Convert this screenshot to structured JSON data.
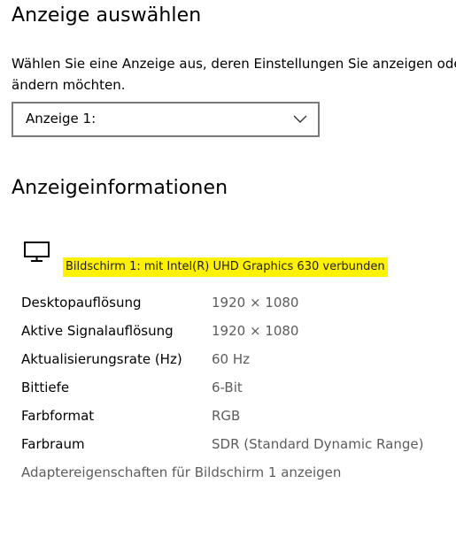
{
  "select_display": {
    "title": "Anzeige auswählen",
    "description_line1": "Wählen Sie eine Anzeige aus, deren Einstellungen Sie anzeigen oder",
    "description_line2": "ändern möchten.",
    "dropdown_value": "Anzeige 1:"
  },
  "display_info": {
    "title": "Anzeigeinformationen",
    "icon": "monitor-icon",
    "adapter_text": "Bildschirm 1: mit Intel(R) UHD Graphics 630 verbunden",
    "highlight_color": "#fff200",
    "rows": [
      {
        "label": "Desktopauflösung",
        "value": "1920 × 1080"
      },
      {
        "label": "Aktive Signalauflösung",
        "value": "1920 × 1080"
      },
      {
        "label": "Aktualisierungsrate (Hz)",
        "value": "60 Hz"
      },
      {
        "label": "Bittiefe",
        "value": "6-Bit"
      },
      {
        "label": "Farbformat",
        "value": "RGB"
      },
      {
        "label": "Farbraum",
        "value": "SDR (Standard Dynamic Range)"
      }
    ],
    "adapter_link": "Adaptereigenschaften für Bildschirm 1 anzeigen"
  }
}
